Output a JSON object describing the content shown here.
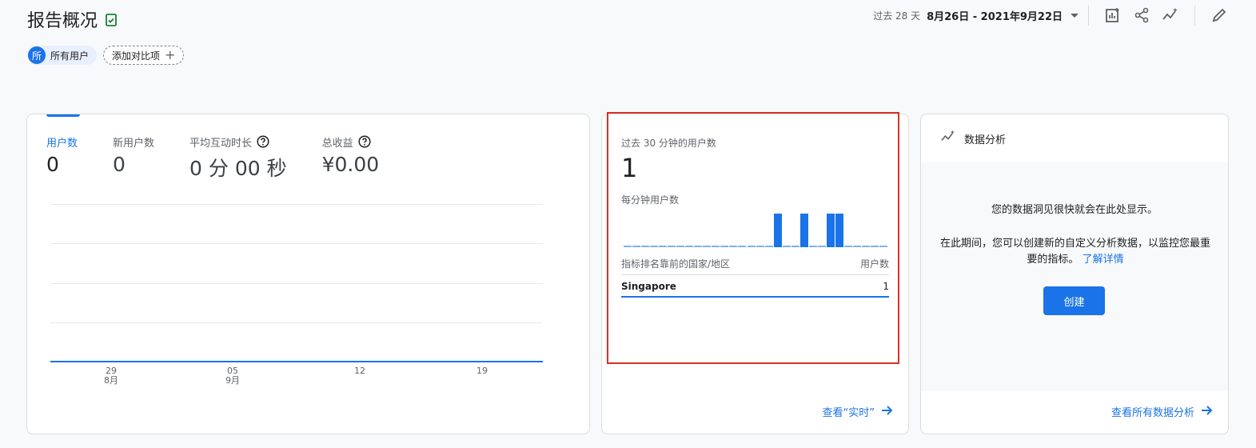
{
  "header": {
    "title": "报告概况",
    "date_prefix": "过去 28 天",
    "date_range": "8月26日 - 2021年9月22日"
  },
  "chips": {
    "avatar_letter": "所",
    "user_segment": "所有用户",
    "add_comparison": "添加对比项"
  },
  "main_card": {
    "metrics": [
      {
        "label": "用户数",
        "value": "0"
      },
      {
        "label": "新用户数",
        "value": "0"
      },
      {
        "label": "平均互动时长",
        "value": "0 分 00 秒"
      },
      {
        "label": "总收益",
        "value": "¥0.00"
      }
    ],
    "xticks": [
      {
        "day": "29",
        "month": "8月"
      },
      {
        "day": "05",
        "month": "9月"
      },
      {
        "day": "12",
        "month": ""
      },
      {
        "day": "19",
        "month": ""
      }
    ]
  },
  "realtime_card": {
    "title": "过去 30 分钟的用户数",
    "value": "1",
    "per_minute_label": "每分钟用户数",
    "per_minute_values": [
      0,
      0,
      0,
      0,
      0,
      0,
      0,
      0,
      0,
      0,
      0,
      0,
      0,
      0,
      0,
      0,
      0,
      1,
      0,
      0,
      1,
      0,
      0,
      1,
      1,
      0,
      0,
      0,
      0,
      0
    ],
    "table_header_left": "指标排名靠前的国家/地区",
    "table_header_right": "用户数",
    "rows": [
      {
        "country": "Singapore",
        "users": "1"
      }
    ],
    "footer_link": "查看“实时”"
  },
  "insights_card": {
    "title": "数据分析",
    "line1": "您的数据洞见很快就会在此处显示。",
    "line2": "在此期间，您可以创建新的自定义分析数据，以监控您最重要的指标。",
    "learn_more": "了解详情",
    "create_button": "创建",
    "footer_link": "查看所有数据分析"
  },
  "colors": {
    "accent": "#1a73e8",
    "highlight": "#d93025",
    "success": "#188038"
  }
}
